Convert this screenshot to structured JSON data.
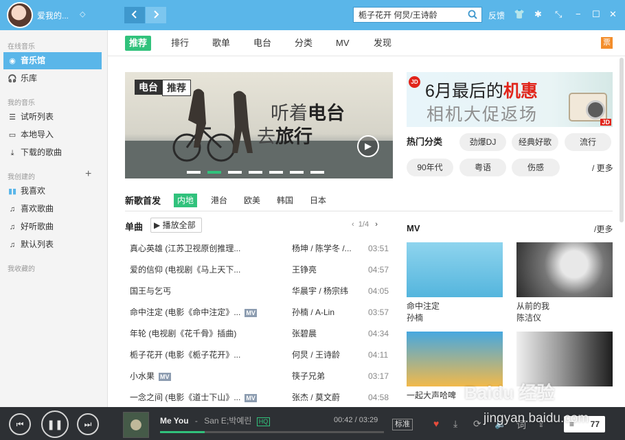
{
  "header": {
    "username": "爱我的...",
    "search_value": "栀子花开 何炅/王诗龄",
    "feedback": "反馈",
    "back_icon": "chevron-left-icon",
    "forward_icon": "chevron-right-icon"
  },
  "sidebar": {
    "online_label": "在线音乐",
    "online_items": [
      {
        "label": "音乐馆",
        "icon": "disc-icon"
      },
      {
        "label": "乐库",
        "icon": "headphones-icon"
      }
    ],
    "mine_label": "我的音乐",
    "mine_items": [
      {
        "label": "试听列表",
        "icon": "list-icon"
      },
      {
        "label": "本地导入",
        "icon": "monitor-icon"
      },
      {
        "label": "下载的歌曲",
        "icon": "download-icon"
      }
    ],
    "created_label": "我创建的",
    "created_items": [
      {
        "label": "我喜欢",
        "icon": "equalizer-icon"
      },
      {
        "label": "喜欢歌曲",
        "icon": "music-note-icon"
      },
      {
        "label": "好听歌曲",
        "icon": "music-note-icon"
      },
      {
        "label": "默认列表",
        "icon": "music-note-icon"
      }
    ],
    "fav_label": "我收藏的"
  },
  "tabs": [
    "推荐",
    "排行",
    "歌单",
    "电台",
    "分类",
    "MV",
    "发现"
  ],
  "ticket": "票",
  "banner": {
    "tag_a": "电台",
    "tag_b": "推荐",
    "line1_normal": "听着",
    "line1_bold": "电台",
    "line2_normal": "去",
    "line2_bold": "旅行",
    "slide_count": 7,
    "active_slide": 1
  },
  "ad": {
    "badge": "JD",
    "title_normal": "6月最后的",
    "title_red": "机惠",
    "subtitle": "相机大促返场",
    "corner": "JD"
  },
  "hot": {
    "title": "热门分类",
    "chips": [
      "劲爆DJ",
      "经典好歌",
      "流行",
      "90年代",
      "粤语",
      "伤感"
    ],
    "more": "/ 更多"
  },
  "new_songs": {
    "title": "新歌首发",
    "regions": [
      "内地",
      "港台",
      "欧美",
      "韩国",
      "日本"
    ]
  },
  "singles": {
    "title": "单曲",
    "play_all": "播放全部",
    "page": "1/4",
    "rows": [
      {
        "title": "真心英雄 (江苏卫视原创推理...",
        "mv": false,
        "artist": "杨坤 / 陈学冬 /...",
        "duration": "03:51"
      },
      {
        "title": "爱的信仰 (电视剧《马上天下...",
        "mv": false,
        "artist": "王铮亮",
        "duration": "04:57"
      },
      {
        "title": "国王与乞丐",
        "mv": false,
        "artist": "华晨宇 / 杨宗纬",
        "duration": "04:05"
      },
      {
        "title": "命中注定 (电影《命中注定》...",
        "mv": true,
        "artist": "孙楠 / A-Lin",
        "duration": "03:57"
      },
      {
        "title": "年轮 (电视剧《花千骨》插曲)",
        "mv": false,
        "artist": "张碧晨",
        "duration": "04:34"
      },
      {
        "title": "栀子花开 (电影《栀子花开》...",
        "mv": false,
        "artist": "何炅 / 王诗龄",
        "duration": "04:11"
      },
      {
        "title": "小水果",
        "mv": true,
        "artist": "筷子兄弟",
        "duration": "03:17"
      },
      {
        "title": "一念之间 (电影《道士下山》...",
        "mv": true,
        "artist": "张杰 / 莫文蔚",
        "duration": "04:58"
      }
    ],
    "mv_badge": "MV"
  },
  "mv": {
    "title": "MV",
    "more": "/更多",
    "cards": [
      {
        "title": "命中注定",
        "artist": "孙楠"
      },
      {
        "title": "从前的我",
        "artist": "陈洁仪"
      },
      {
        "title": "一起大声哈啤",
        "artist": ""
      },
      {
        "title": "",
        "artist": ""
      }
    ]
  },
  "player": {
    "song": "Me You",
    "separator": "-",
    "singer": "San E;박예린",
    "hq_badge": "HQ",
    "elapsed": "00:42",
    "total": "03:29",
    "progress": 0.2,
    "quality": "标准",
    "list_label": "≡",
    "list_count": "77"
  },
  "watermark": {
    "top": "Baidu 经验",
    "bottom": "jingyan.baidu.com"
  },
  "colors": {
    "accent": "#5ab6e9",
    "green": "#31c27c",
    "player_bg": "#2d3034"
  }
}
